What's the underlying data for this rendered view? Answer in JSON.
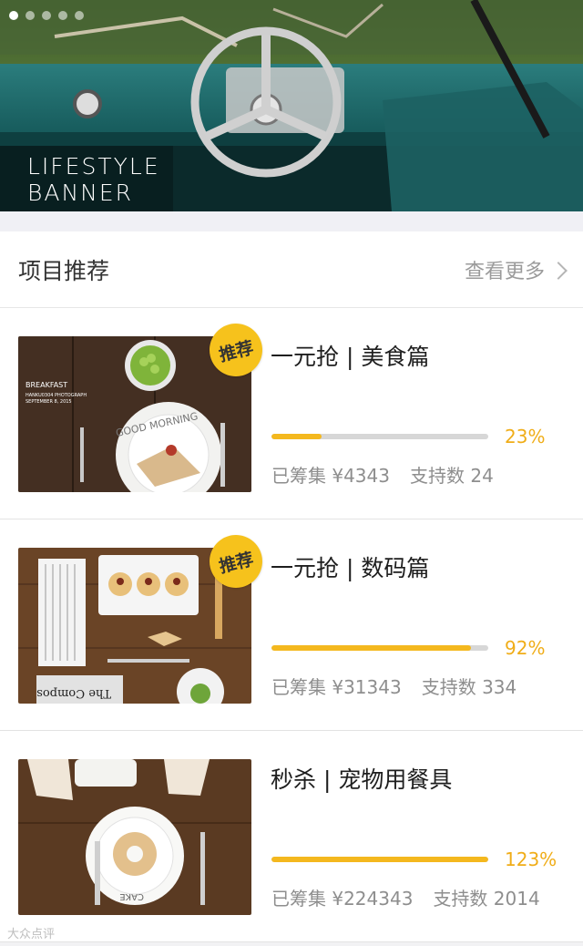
{
  "banner": {
    "text_line1": "LIFESTYLE",
    "text_line2": "BANNER",
    "dots_count": 5,
    "active_dot": 0
  },
  "section": {
    "title": "项目推荐",
    "more_label": "查看更多"
  },
  "colors": {
    "accent": "#f4b81e",
    "badge": "#f6c21c",
    "percent_text": "#f0ad18"
  },
  "cards": [
    {
      "badge": "推荐",
      "title": "一元抢 | 美食篇",
      "progress": 0.23,
      "percent": "23%",
      "raised": "已筹集 ¥4343",
      "supporters": "支持数 24",
      "image_text": {
        "line1": "BREAKFAST",
        "line2": "HANKU0304 PHOTOGRAPH",
        "line3": "SEPTEMBER 8, 2015",
        "plate": "GOOD MORNING"
      }
    },
    {
      "badge": "推荐",
      "title": "一元抢 | 数码篇",
      "progress": 0.92,
      "percent": "92%",
      "raised": "已筹集 ¥31343",
      "supporters": "支持数 334",
      "image_text": {
        "paper": "The Compos"
      }
    },
    {
      "badge": "",
      "title": "秒杀 | 宠物用餐具",
      "progress": 1.0,
      "percent": "123%",
      "raised": "已筹集 ¥224343",
      "supporters": "支持数 2014",
      "image_text": {
        "plate": "CAKE"
      }
    }
  ],
  "watermark": "大众点评"
}
